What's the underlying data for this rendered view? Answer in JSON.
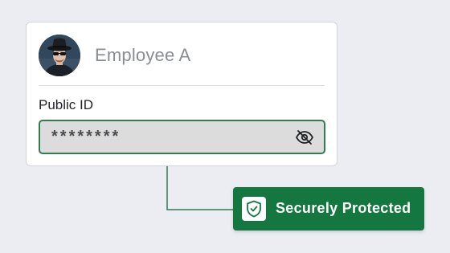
{
  "employee": {
    "name": "Employee A"
  },
  "field": {
    "label": "Public ID",
    "masked_value": "********",
    "visibility_icon": "eye-off-icon"
  },
  "badge": {
    "label": "Securely Protected",
    "icon": "shield-check-icon"
  },
  "colors": {
    "accent_green": "#13773f",
    "field_border": "#2d7d4f",
    "background": "#ecedf3"
  }
}
